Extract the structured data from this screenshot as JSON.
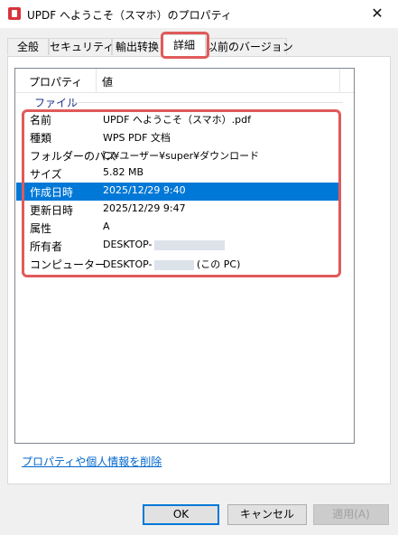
{
  "window": {
    "title": "UPDF へようこそ（スマホ）のプロパティ",
    "close_glyph": "✕"
  },
  "tabs": [
    {
      "label": "全般"
    },
    {
      "label": "セキュリティ"
    },
    {
      "label": "輸出转换"
    },
    {
      "label": "詳細"
    },
    {
      "label": "以前のバージョン"
    }
  ],
  "list": {
    "columns": {
      "property": "プロパティ",
      "value": "値"
    },
    "group": "ファイル",
    "rows": [
      {
        "name": "名前",
        "value": "UPDF へようこそ（スマホ）.pdf"
      },
      {
        "name": "種類",
        "value": "WPS PDF 文档"
      },
      {
        "name": "フォルダーのパス",
        "value": "C:¥ユーザー¥super¥ダウンロード"
      },
      {
        "name": "サイズ",
        "value": "5.82 MB"
      },
      {
        "name": "作成日時",
        "value": "2025/12/29 9:40"
      },
      {
        "name": "更新日時",
        "value": "2025/12/29 9:47"
      },
      {
        "name": "属性",
        "value": "A"
      },
      {
        "name": "所有者",
        "value": "DESKTOP-"
      },
      {
        "name": "コンピューター",
        "value": "DESKTOP-",
        "suffix": "(この PC)"
      }
    ]
  },
  "remove_link": "プロパティや個人情報を削除",
  "buttons": {
    "ok": "OK",
    "cancel": "キャンセル",
    "apply": "適用(A)"
  }
}
